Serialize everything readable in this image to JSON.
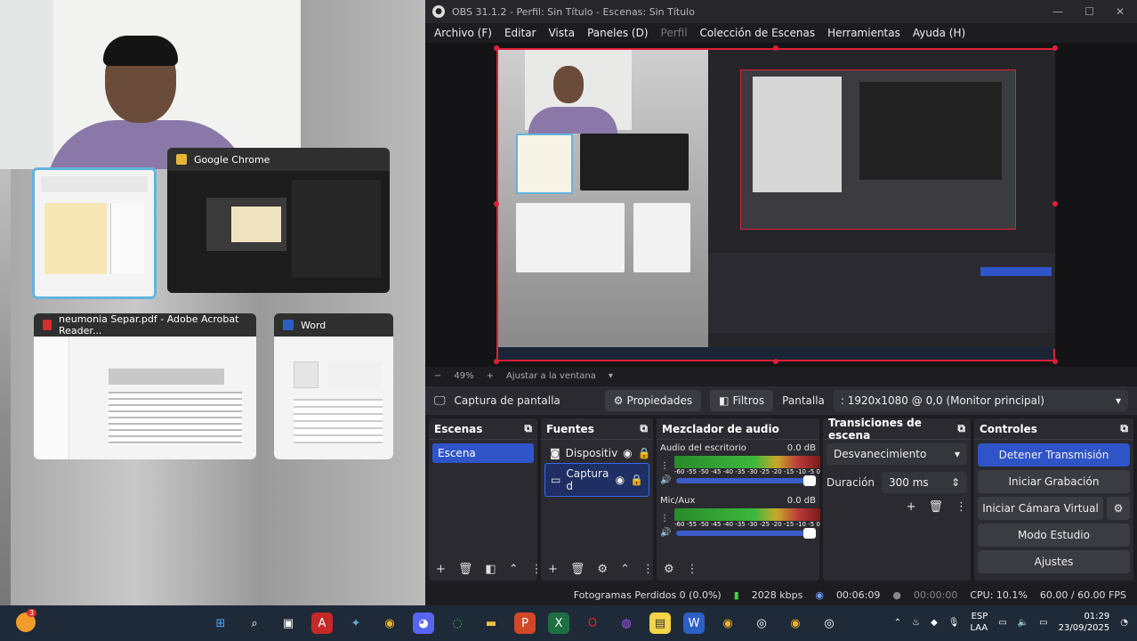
{
  "desktop": {
    "windows": [
      {
        "title": "Google Chrome",
        "selected": false
      },
      {
        "title": "neumonia Separ.pdf - Adobe Acrobat Reader...",
        "selected": false
      },
      {
        "title": "Word",
        "selected": false
      }
    ]
  },
  "obs": {
    "title": "OBS 31.1.2 - Perfil: Sin Título - Escenas: Sin Título",
    "menu": [
      "Archivo (F)",
      "Editar",
      "Vista",
      "Paneles (D)",
      "Perfil",
      "Colección de Escenas",
      "Herramientas",
      "Ayuda (H)"
    ],
    "zoom": {
      "percent": "49%",
      "fit": "Ajustar a la ventana"
    },
    "source_bar": {
      "source_name": "Captura de pantalla",
      "properties": "Propiedades",
      "filters": "Filtros",
      "display_label": "Pantalla",
      "display_value": ": 1920x1080 @ 0,0 (Monitor principal)"
    },
    "scenes": {
      "title": "Escenas",
      "items": [
        "Escena"
      ]
    },
    "sources": {
      "title": "Fuentes",
      "items": [
        "Dispositiv",
        "Captura d"
      ]
    },
    "mixer": {
      "title": "Mezclador de audio",
      "channels": [
        {
          "name": "Audio del escritorio",
          "db": "0.0 dB",
          "scale": "-60 -55 -50 -45 -40 -35 -30 -25 -20 -15 -10 -5 0"
        },
        {
          "name": "Mic/Aux",
          "db": "0.0 dB",
          "scale": "-60 -55 -50 -45 -40 -35 -30 -25 -20 -15 -10 -5 0"
        }
      ]
    },
    "transitions": {
      "title": "Transiciones de escena",
      "type": "Desvanecimiento",
      "duration_label": "Duración",
      "duration_value": "300 ms"
    },
    "controls": {
      "title": "Controles",
      "buttons": [
        "Detener Transmisión",
        "Iniciar Grabación",
        "Iniciar Cámara Virtual",
        "Modo Estudio",
        "Ajustes"
      ]
    },
    "status": {
      "dropped": "Fotogramas Perdidos 0 (0.0%)",
      "bitrate": "2028 kbps",
      "stream_time": "00:06:09",
      "rec_time": "00:00:00",
      "cpu": "CPU: 10.1%",
      "fps": "60.00 / 60.00 FPS"
    }
  },
  "taskbar": {
    "weather_badge": "3",
    "lang": "ESP",
    "lang2": "LAA",
    "time": "01:29",
    "date": "23/09/2025"
  },
  "colors": {
    "accent": "#2f54c8",
    "preview_border": "#e0203a",
    "selection": "#62b4de"
  }
}
